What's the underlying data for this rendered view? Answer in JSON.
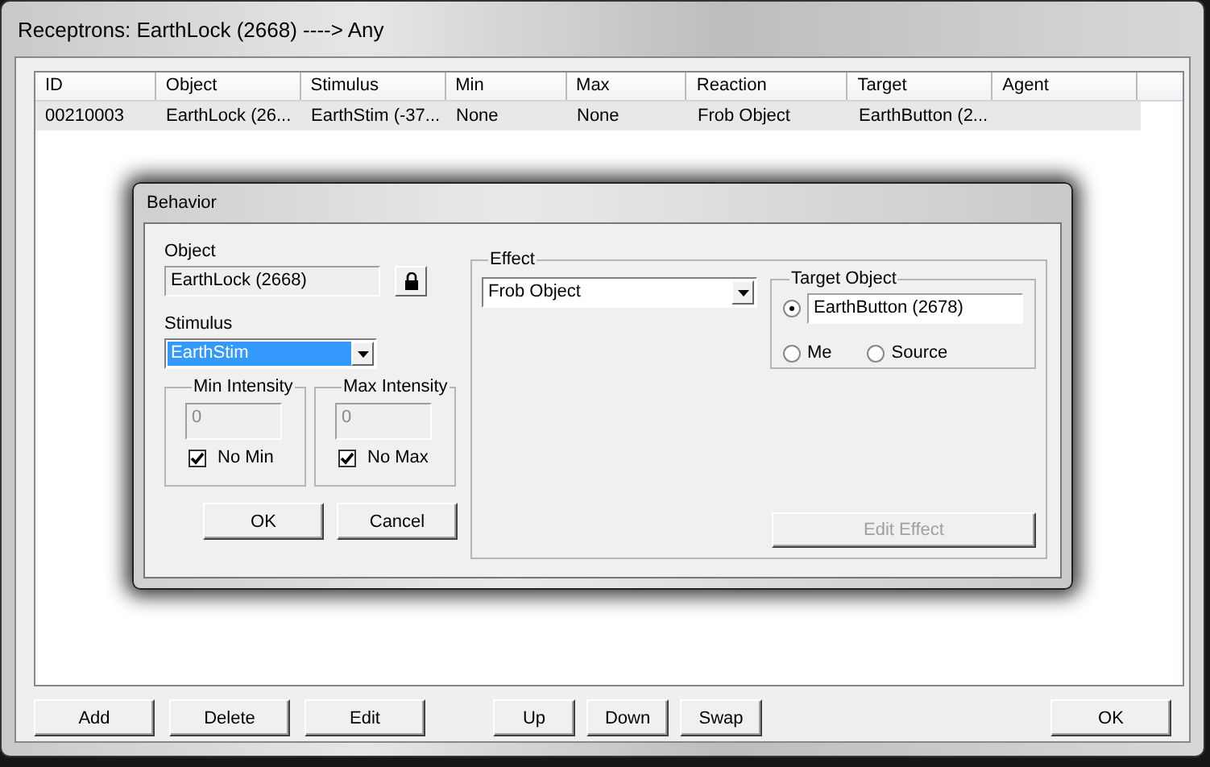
{
  "window": {
    "title": "Receptrons: EarthLock (2668) ----> Any"
  },
  "list": {
    "columns": [
      "ID",
      "Object",
      "Stimulus",
      "Min",
      "Max",
      "Reaction",
      "Target",
      "Agent"
    ],
    "rows": [
      {
        "selected": true,
        "cells": [
          "00210003",
          "EarthLock (26...",
          "EarthStim (-37...",
          "None",
          "None",
          "Frob Object",
          "EarthButton (2...",
          ""
        ]
      }
    ]
  },
  "dialog": {
    "title": "Behavior",
    "object": {
      "label": "Object",
      "value": "EarthLock (2668)"
    },
    "stimulus": {
      "label": "Stimulus",
      "value": "EarthStim",
      "selected": true
    },
    "intensity": [
      {
        "title": "Min Intensity",
        "value": "0",
        "disabled": true,
        "check_label": "No Min",
        "checked": true
      },
      {
        "title": "Max Intensity",
        "value": "0",
        "disabled": true,
        "check_label": "No Max",
        "checked": true
      }
    ],
    "buttons": [
      {
        "label": "OK",
        "disabled": false
      },
      {
        "label": "Cancel",
        "disabled": false
      }
    ],
    "effect": {
      "title": "Effect",
      "value": "Frob Object",
      "target": {
        "title": "Target Object",
        "options": [
          {
            "kind": "field",
            "value": "EarthButton (2678)",
            "selected": true
          },
          {
            "kind": "label",
            "label": "Me",
            "selected": false
          },
          {
            "kind": "label",
            "label": "Source",
            "selected": false
          }
        ]
      },
      "edit_button": {
        "label": "Edit Effect",
        "disabled": true
      }
    }
  },
  "button_groups": [
    [
      "Add",
      "Delete",
      "Edit"
    ],
    [
      "Up",
      "Down",
      "Swap"
    ],
    [
      "OK"
    ]
  ]
}
